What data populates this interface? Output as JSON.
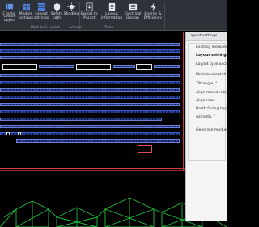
{
  "ribbon": {
    "buttons": [
      {
        "name": "create-button",
        "icon": "pv-create-icon",
        "label": "Create"
      },
      {
        "name": "create-object-button",
        "icon": "object-icon",
        "label": "Create\nobject"
      },
      {
        "name": "module-settings-button",
        "icon": "module-settings-icon",
        "label": "Module\nsettings"
      },
      {
        "name": "layout-settings-button",
        "icon": "layout-settings-icon",
        "label": "Layout\nsettings"
      },
      {
        "name": "safety-path-button",
        "icon": "safety-path-icon",
        "label": "Safety\npath"
      },
      {
        "name": "shading-button",
        "icon": "shading-icon",
        "label": "Shading"
      },
      {
        "name": "export-pvsyst-button",
        "icon": "export-icon",
        "label": "Export to\nPVsyst"
      },
      {
        "name": "layout-information-button",
        "icon": "information-icon",
        "label": "Layout\ninformation"
      },
      {
        "name": "electrical-design-button",
        "icon": "electrical-icon",
        "label": "Electrical\nDesign"
      },
      {
        "name": "energy-efficiency-button",
        "icon": "energy-icon",
        "label": "Energy &\nEfficiency"
      }
    ],
    "groups": {
      "module_layout": "Module & layout",
      "actions": "Actions",
      "tools": "Tools"
    },
    "accent": "#3f82e6"
  },
  "panel": {
    "title": "Layout settings",
    "items": [
      {
        "label": "Existing modules",
        "bold": false
      },
      {
        "label": "Layout settings",
        "bold": true
      },
      {
        "label": "Layout type accor",
        "bold": false
      },
      {
        "label": "Module orientatio",
        "bold": false
      },
      {
        "label": "Tilt angle, °",
        "bold": false
      },
      {
        "label": "Align modules by",
        "bold": false
      },
      {
        "label": "Align rows",
        "bold": false
      },
      {
        "label": "North facing layo",
        "bold": false
      },
      {
        "label": "Azimuth, °",
        "bold": false
      },
      {
        "label": "Generate module",
        "bold": false
      }
    ]
  },
  "colors": {
    "module_fill": "#243a86",
    "module_border": "#6d7fd6",
    "boundary": "#cf3d3d",
    "floor_pattern": "#1fbf3a"
  }
}
